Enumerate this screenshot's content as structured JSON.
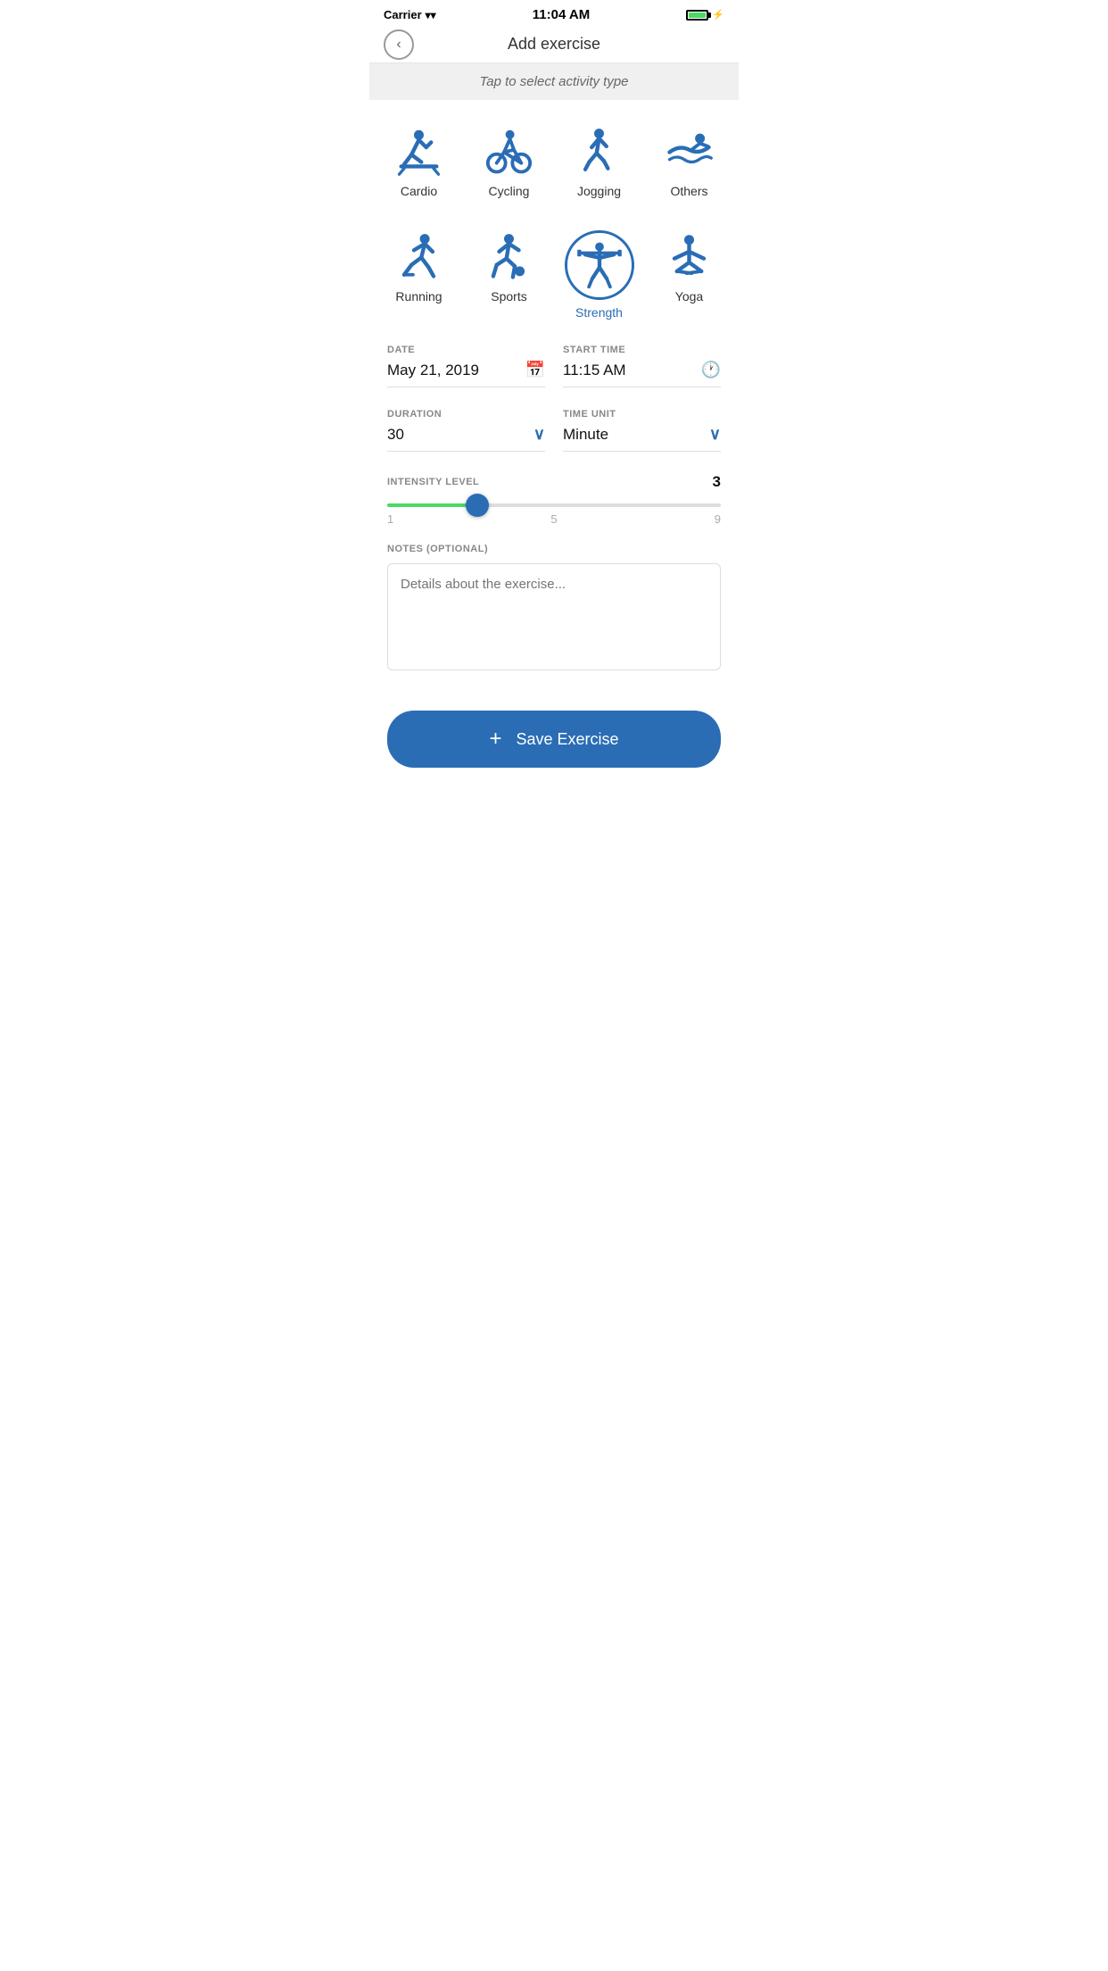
{
  "statusBar": {
    "carrier": "Carrier",
    "time": "11:04 AM",
    "wifi": true,
    "battery": 90
  },
  "header": {
    "title": "Add exercise",
    "backLabel": "‹"
  },
  "activityBanner": {
    "text": "Tap to select activity type"
  },
  "activities": {
    "row1": [
      {
        "id": "cardio",
        "label": "Cardio",
        "selected": false
      },
      {
        "id": "cycling",
        "label": "Cycling",
        "selected": false
      },
      {
        "id": "jogging",
        "label": "Jogging",
        "selected": false
      },
      {
        "id": "others",
        "label": "Others",
        "selected": false
      }
    ],
    "row2": [
      {
        "id": "running",
        "label": "Running",
        "selected": false
      },
      {
        "id": "sports",
        "label": "Sports",
        "selected": false
      },
      {
        "id": "strength",
        "label": "Strength",
        "selected": true
      },
      {
        "id": "yoga",
        "label": "Yoga",
        "selected": false
      }
    ]
  },
  "form": {
    "dateLabel": "DATE",
    "dateValue": "May 21, 2019",
    "startTimeLabel": "START TIME",
    "startTimeValue": "11:15 AM",
    "durationLabel": "DURATION",
    "durationValue": "30",
    "timeUnitLabel": "TIME UNIT",
    "timeUnitValue": "Minute"
  },
  "intensity": {
    "label": "INTENSITY LEVEL",
    "value": "3",
    "min": "1",
    "mid": "5",
    "max": "9",
    "current": 3,
    "sliderMin": 1,
    "sliderMax": 9
  },
  "notes": {
    "label": "NOTES (OPTIONAL)",
    "placeholder": "Details about the exercise..."
  },
  "saveButton": {
    "label": "Save Exercise",
    "plusSign": "+"
  }
}
